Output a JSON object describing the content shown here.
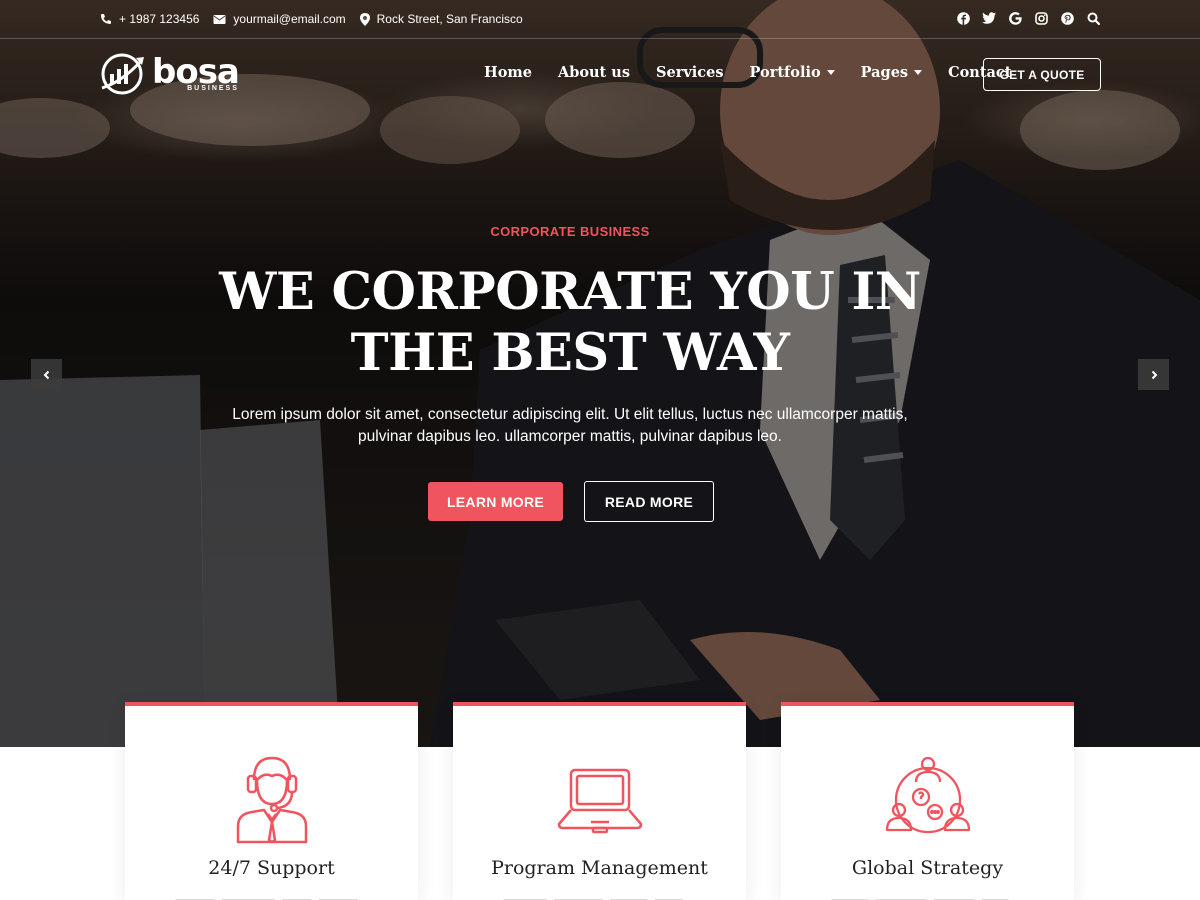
{
  "topbar": {
    "phone": "+ 1987 123456",
    "email": "yourmail@email.com",
    "address": "Rock Street, San Francisco",
    "social": [
      "facebook-icon",
      "twitter-icon",
      "google-icon",
      "instagram-icon",
      "pinterest-icon",
      "search-icon"
    ]
  },
  "header": {
    "brand": "bosa",
    "brand_sub": "BUSINESS",
    "nav": [
      {
        "label": "Home"
      },
      {
        "label": "About us"
      },
      {
        "label": "Services"
      },
      {
        "label": "Portfolio"
      },
      {
        "label": "Pages"
      },
      {
        "label": "Contact"
      }
    ],
    "cta": "GET A QUOTE"
  },
  "hero": {
    "eyebrow": "CORPORATE BUSINESS",
    "headline_line1": "WE CORPORATE YOU IN",
    "headline_line2": "THE BEST WAY",
    "lead": "Lorem ipsum dolor sit amet, consectetur adipiscing elit. Ut elit tellus, luctus nec ullamcorper mattis, pulvinar dapibus leo. ullamcorper mattis, pulvinar dapibus leo.",
    "btn_primary": "LEARN MORE",
    "btn_secondary": "READ MORE"
  },
  "features": [
    {
      "title": "24/7 Support",
      "icon": "support-agent-icon"
    },
    {
      "title": "Program Management",
      "icon": "laptop-icon"
    },
    {
      "title": "Global Strategy",
      "icon": "team-network-icon"
    }
  ],
  "colors": {
    "accent": "#f0545e",
    "text_dark": "#222222"
  }
}
